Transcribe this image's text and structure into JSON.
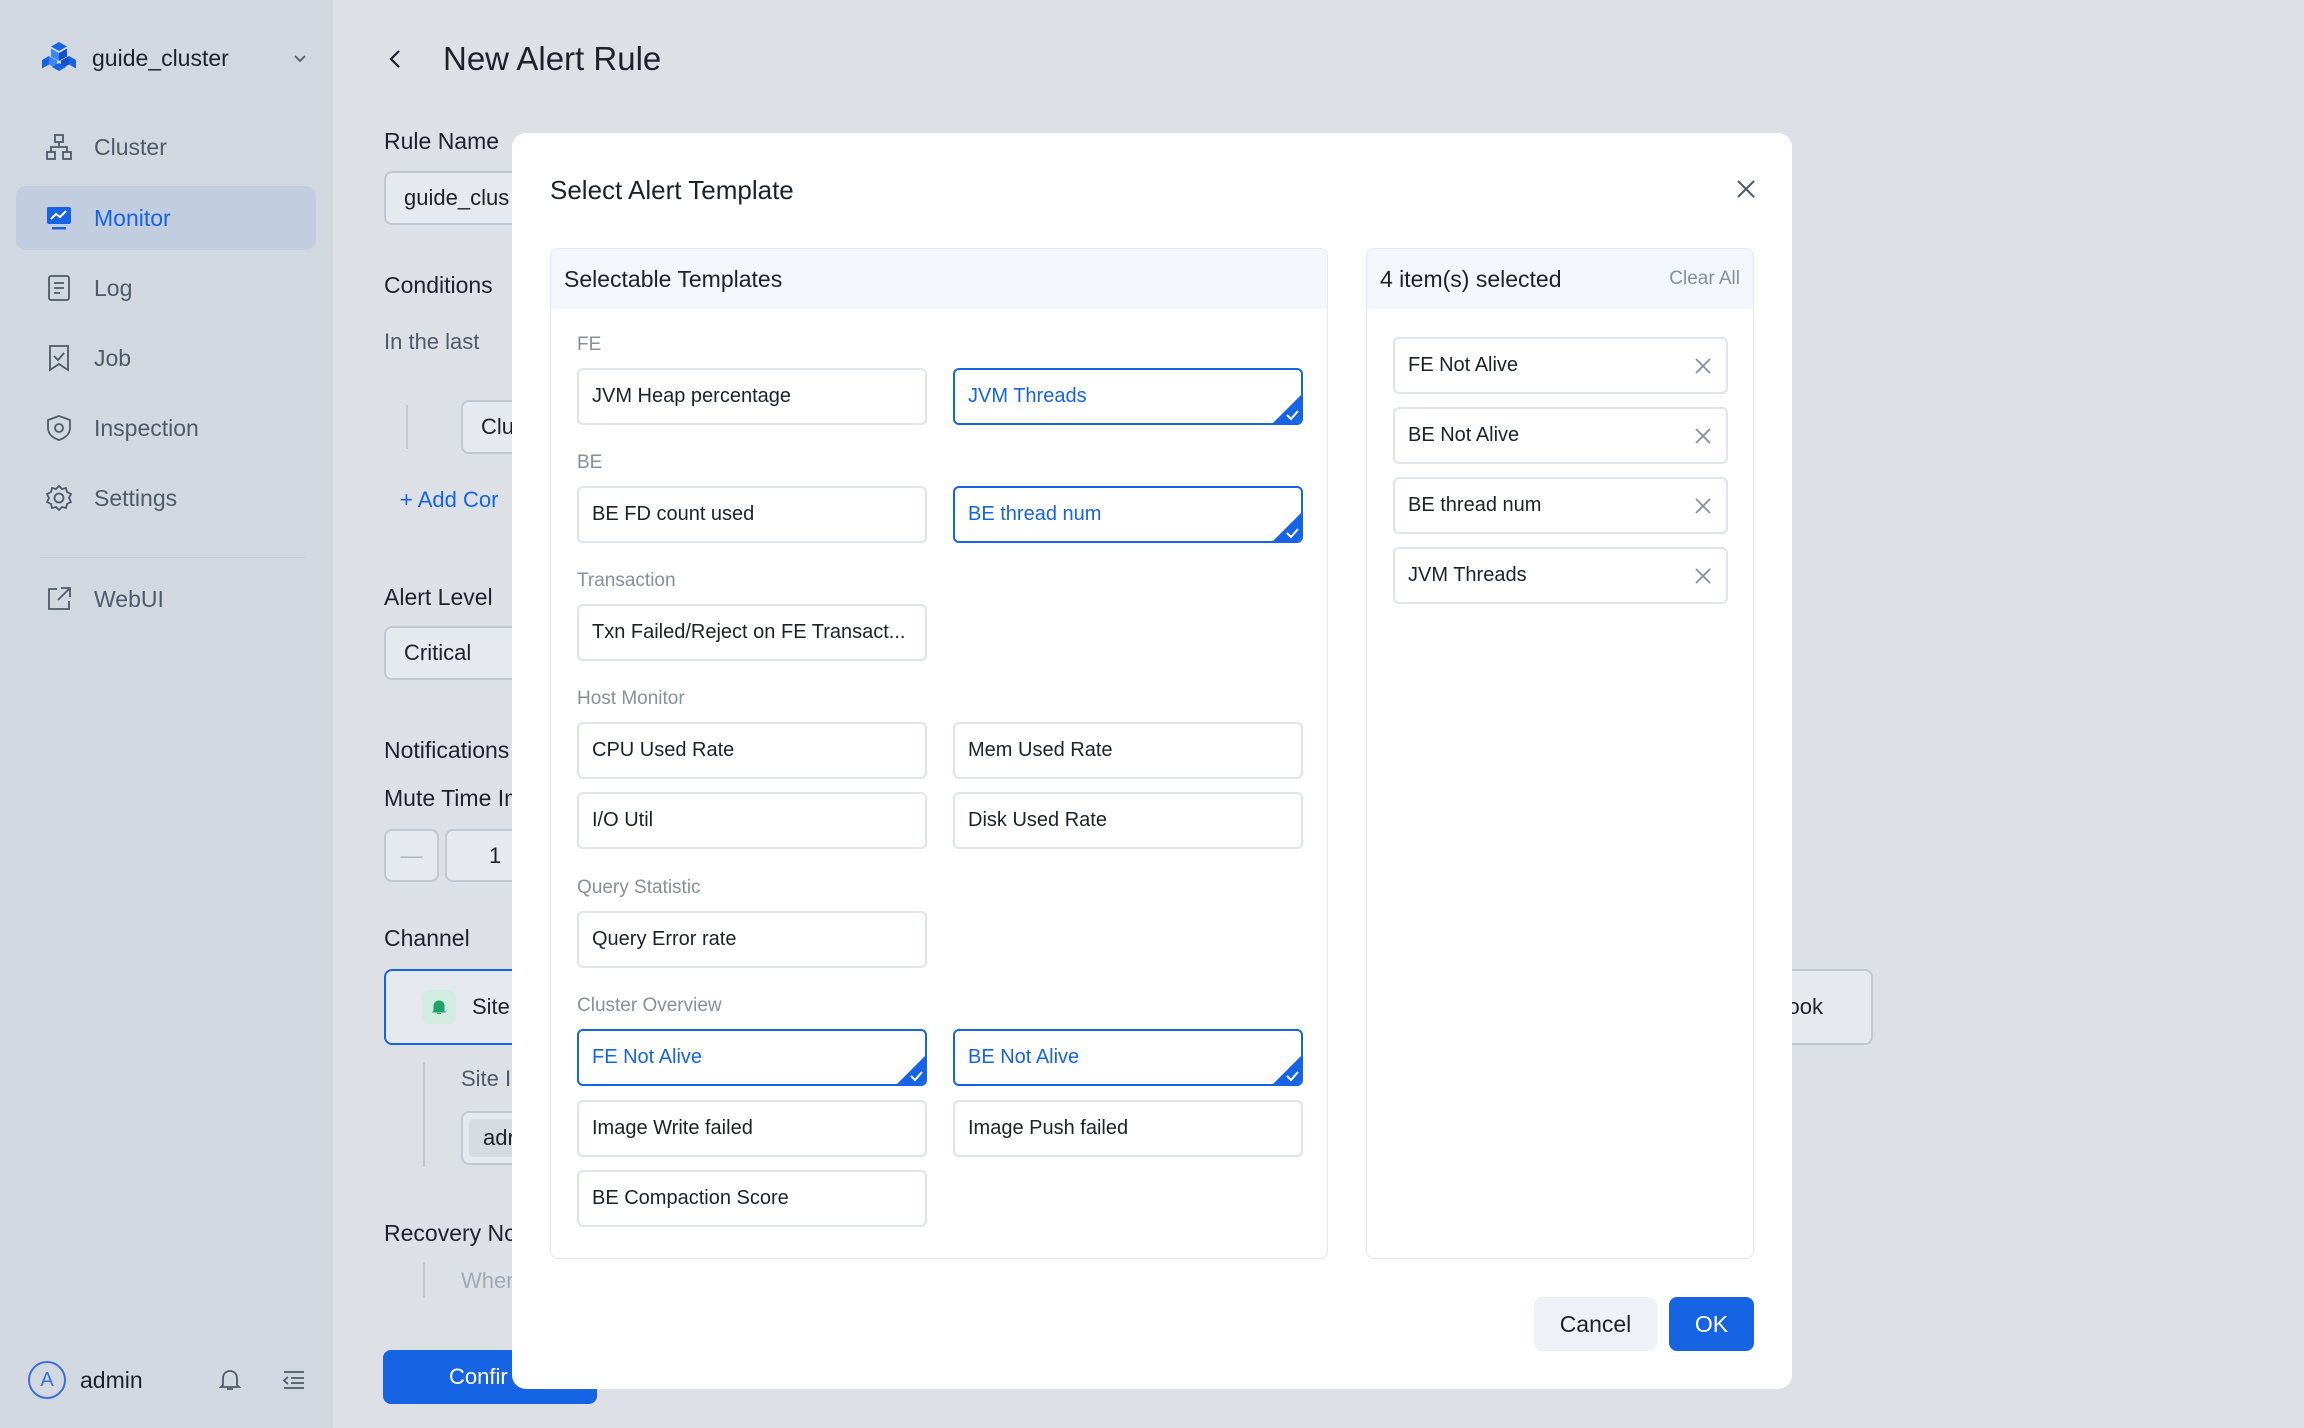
{
  "sidebar": {
    "cluster_name": "guide_cluster",
    "items": [
      {
        "label": "Cluster",
        "icon": "cluster-icon"
      },
      {
        "label": "Monitor",
        "icon": "monitor-icon",
        "active": true
      },
      {
        "label": "Log",
        "icon": "log-icon"
      },
      {
        "label": "Job",
        "icon": "job-icon"
      },
      {
        "label": "Inspection",
        "icon": "inspection-icon"
      },
      {
        "label": "Settings",
        "icon": "gear-icon"
      },
      {
        "label": "WebUI",
        "icon": "external-link-icon"
      }
    ],
    "user": {
      "avatar_letter": "A",
      "name": "admin"
    }
  },
  "page": {
    "title": "New Alert Rule",
    "rule_name_label": "Rule Name",
    "rule_name_value": "guide_clus",
    "conditions_label": "Conditions",
    "in_the_last": "In the last",
    "condition_field": "Clu",
    "add_condition": "+ Add Cor",
    "alert_level_label": "Alert Level",
    "alert_level_value": "Critical",
    "notifications_label": "Notifications",
    "mute_time_label": "Mute Time In",
    "mute_minus": "—",
    "mute_value": "1",
    "channel_label": "Channel",
    "channel_site": "Site",
    "channel_webhook": "ook",
    "site_label": "Site I",
    "site_value": "adr",
    "recovery_label": "Recovery No",
    "recovery_hint": "When",
    "confirm_button": "Confir"
  },
  "modal": {
    "title": "Select Alert Template",
    "left_header": "Selectable Templates",
    "groups": {
      "fe": {
        "label": "FE",
        "items": [
          "JVM Heap percentage",
          "JVM Threads"
        ]
      },
      "be": {
        "label": "BE",
        "items": [
          "BE FD count used",
          "BE thread num"
        ]
      },
      "txn": {
        "label": "Transaction",
        "items": [
          "Txn Failed/Reject on FE Transact..."
        ]
      },
      "host": {
        "label": "Host Monitor",
        "items": [
          "CPU Used Rate",
          "Mem Used Rate",
          "I/O Util",
          "Disk Used Rate"
        ]
      },
      "query": {
        "label": "Query Statistic",
        "items": [
          "Query Error rate"
        ]
      },
      "cluster": {
        "label": "Cluster Overview",
        "items": [
          "FE Not Alive",
          "BE Not Alive",
          "Image Write failed",
          "Image Push failed",
          "BE Compaction Score"
        ]
      }
    },
    "selected_count": "4 item(s) selected",
    "clear_all": "Clear All",
    "selected_items": [
      "FE Not Alive",
      "BE Not Alive",
      "BE thread num",
      "JVM Threads"
    ],
    "cancel_label": "Cancel",
    "ok_label": "OK"
  },
  "colors": {
    "accent": "#1664e3",
    "sidebar_bg": "#d2d8e0",
    "active_bg": "#c2cde0"
  }
}
